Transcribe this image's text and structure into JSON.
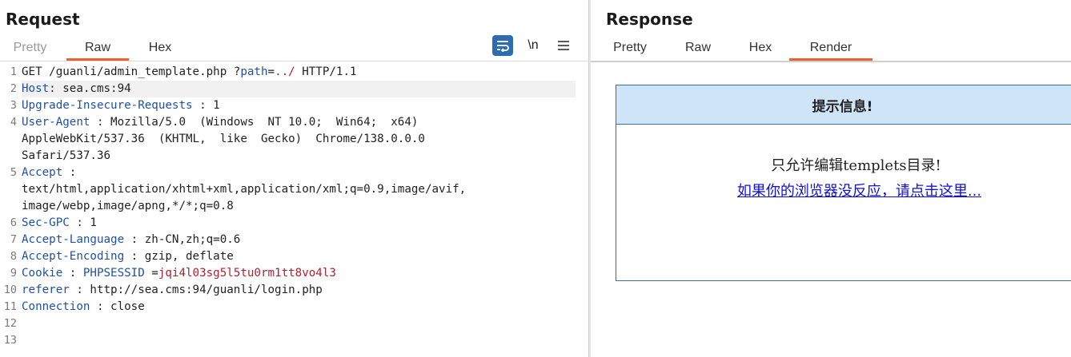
{
  "request": {
    "title": "Request",
    "tabs": [
      "Pretty",
      "Raw",
      "Hex"
    ],
    "active_tab": "Raw",
    "toolbar": {
      "wrap_icon": "wrap-lines-icon",
      "newline_label": "\\n",
      "menu_icon": "hamburger-menu-icon"
    },
    "lines": [
      {
        "num": "1",
        "segments": [
          {
            "t": "GET /guanli/admin_template.php ?"
          },
          {
            "t": "path",
            "c": "blue"
          },
          {
            "t": "="
          },
          {
            "t": "../",
            "c": "red"
          },
          {
            "t": " HTTP/1.1"
          }
        ]
      },
      {
        "num": "2",
        "segments": [
          {
            "t": "Host",
            "c": "hdr"
          },
          {
            "t": ": sea.cms:94"
          }
        ]
      },
      {
        "num": "3",
        "segments": [
          {
            "t": "Upgrade-Insecure-Requests",
            "c": "hdr"
          },
          {
            "t": " : 1"
          }
        ]
      },
      {
        "num": "4",
        "segments": [
          {
            "t": "User-Agent",
            "c": "hdr"
          },
          {
            "t": " : Mozilla/5.0  (Windows  NT 10.0;  Win64;  x64)"
          }
        ]
      },
      {
        "num": "",
        "segments": [
          {
            "t": "AppleWebKit/537.36  (KHTML,  like  Gecko)  Chrome/138.0.0.0"
          }
        ]
      },
      {
        "num": "",
        "segments": [
          {
            "t": "Safari/537.36"
          }
        ]
      },
      {
        "num": "5",
        "segments": [
          {
            "t": "Accept",
            "c": "hdr"
          },
          {
            "t": " :"
          }
        ]
      },
      {
        "num": "",
        "segments": [
          {
            "t": "text/html,application/xhtml+xml,application/xml;q=0.9,image/avif,"
          }
        ]
      },
      {
        "num": "",
        "segments": [
          {
            "t": "image/webp,image/apng,*/*;q=0.8"
          }
        ]
      },
      {
        "num": "6",
        "segments": [
          {
            "t": "Sec-GPC",
            "c": "hdr"
          },
          {
            "t": " : 1"
          }
        ]
      },
      {
        "num": "7",
        "segments": [
          {
            "t": "Accept-Language",
            "c": "hdr"
          },
          {
            "t": " : zh-CN,zh;q=0.6"
          }
        ]
      },
      {
        "num": "8",
        "segments": [
          {
            "t": "Accept-Encoding",
            "c": "hdr"
          },
          {
            "t": " : gzip, deflate"
          }
        ]
      },
      {
        "num": "9",
        "segments": [
          {
            "t": "Cookie",
            "c": "hdr"
          },
          {
            "t": " : "
          },
          {
            "t": "PHPSESSID",
            "c": "blue"
          },
          {
            "t": " ="
          },
          {
            "t": "jqi4l03sg5l5tu0rm1tt8vo4l3",
            "c": "red"
          }
        ]
      },
      {
        "num": "10",
        "segments": [
          {
            "t": "referer",
            "c": "hdr"
          },
          {
            "t": " : http://sea.cms:94/guanli/login.php"
          }
        ]
      },
      {
        "num": "11",
        "segments": [
          {
            "t": "Connection",
            "c": "hdr"
          },
          {
            "t": " : close"
          }
        ]
      },
      {
        "num": "12",
        "segments": [
          {
            "t": ""
          }
        ]
      },
      {
        "num": "13",
        "segments": [
          {
            "t": ""
          }
        ]
      }
    ]
  },
  "response": {
    "title": "Response",
    "tabs": [
      "Pretty",
      "Raw",
      "Hex",
      "Render"
    ],
    "active_tab": "Render",
    "render": {
      "heading": "提示信息!",
      "message": "只允许编辑templets目录!",
      "link": "如果你的浏览器没反应，请点击这里..."
    }
  },
  "colors": {
    "accent": "#e8622e",
    "header_name": "#1f51a5",
    "value_red": "#b0202f",
    "render_header_bg": "#cfe4f7",
    "link": "#1010e0"
  }
}
